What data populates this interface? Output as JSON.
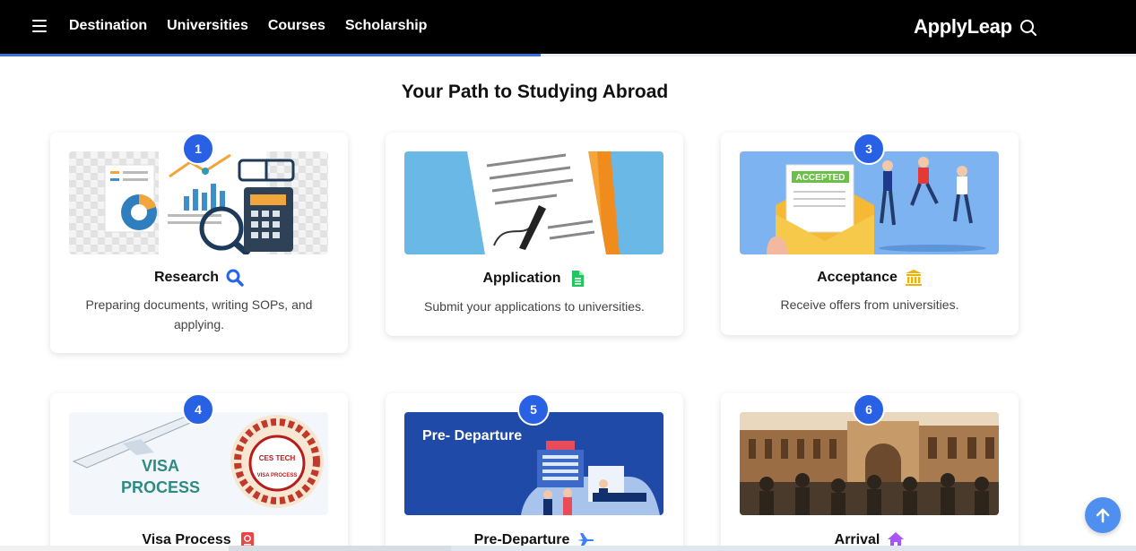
{
  "nav": {
    "items": [
      "Destination",
      "Universities",
      "Courses",
      "Scholarship"
    ],
    "brand": "ApplyLeap"
  },
  "reading_progress": 0.476,
  "section": {
    "title": "Your Path to Studying Abroad"
  },
  "steps": [
    {
      "number": "1",
      "title": "Research",
      "description": "Preparing documents, writing SOPs, and applying.",
      "icon": "search-icon",
      "icon_color": "#2563eb"
    },
    {
      "number": "2",
      "title": "Application",
      "description": "Submit your applications to universities.",
      "icon": "document-icon",
      "icon_color": "#22c55e"
    },
    {
      "number": "3",
      "title": "Acceptance",
      "description": "Receive offers from universities.",
      "icon": "university-icon",
      "icon_color": "#eab308"
    },
    {
      "number": "4",
      "title": "Visa Process",
      "description": "",
      "icon": "passport-icon",
      "icon_color": "#ef4444",
      "image_text": {
        "line1": "VISA",
        "line2": "PROCESS",
        "seal": "CES TECH",
        "seal_sub": "VISA PROCESS"
      }
    },
    {
      "number": "5",
      "title": "Pre-Departure",
      "description": "",
      "icon": "plane-icon",
      "icon_color": "#3b82f6",
      "image_text": {
        "heading": "Pre- Departure"
      }
    },
    {
      "number": "6",
      "title": "Arrival",
      "description": "",
      "icon": "home-icon",
      "icon_color": "#a855f7"
    }
  ],
  "acceptance_image": {
    "stamp": "ACCEPTED"
  },
  "colors": {
    "accent": "#2961e4",
    "topbar": "#000000",
    "scroll_button": "#4f8ff0"
  }
}
